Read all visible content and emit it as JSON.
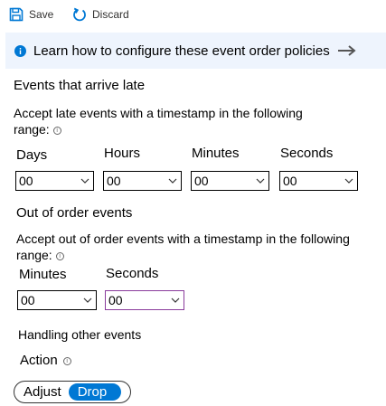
{
  "toolbar": {
    "save_label": "Save",
    "discard_label": "Discard",
    "accent": "#0078d4"
  },
  "info_bar": {
    "text": "Learn how to configure these event order policies",
    "icon": "info-icon",
    "arrow_icon": "arrow-right-icon",
    "background": "#eef4fd"
  },
  "late_events": {
    "title": "Events that arrive late",
    "description_line1": "Accept late events with a timestamp in the following",
    "description_line2": "range:",
    "fields": [
      {
        "label": "Days",
        "value": "00"
      },
      {
        "label": "Hours",
        "value": "00"
      },
      {
        "label": "Minutes",
        "value": "00"
      },
      {
        "label": "Seconds",
        "value": "00"
      }
    ]
  },
  "out_of_order": {
    "title": "Out of order events",
    "description_line1": "Accept out of order events with a timestamp in the following",
    "description_line2": "range:",
    "fields": [
      {
        "label": "Minutes",
        "value": "00"
      },
      {
        "label": "Seconds",
        "value": "00"
      }
    ]
  },
  "other_events": {
    "title": "Handling other events",
    "action_label": "Action",
    "toggle": {
      "options": [
        "Adjust",
        "Drop"
      ],
      "selected": "Drop"
    }
  }
}
